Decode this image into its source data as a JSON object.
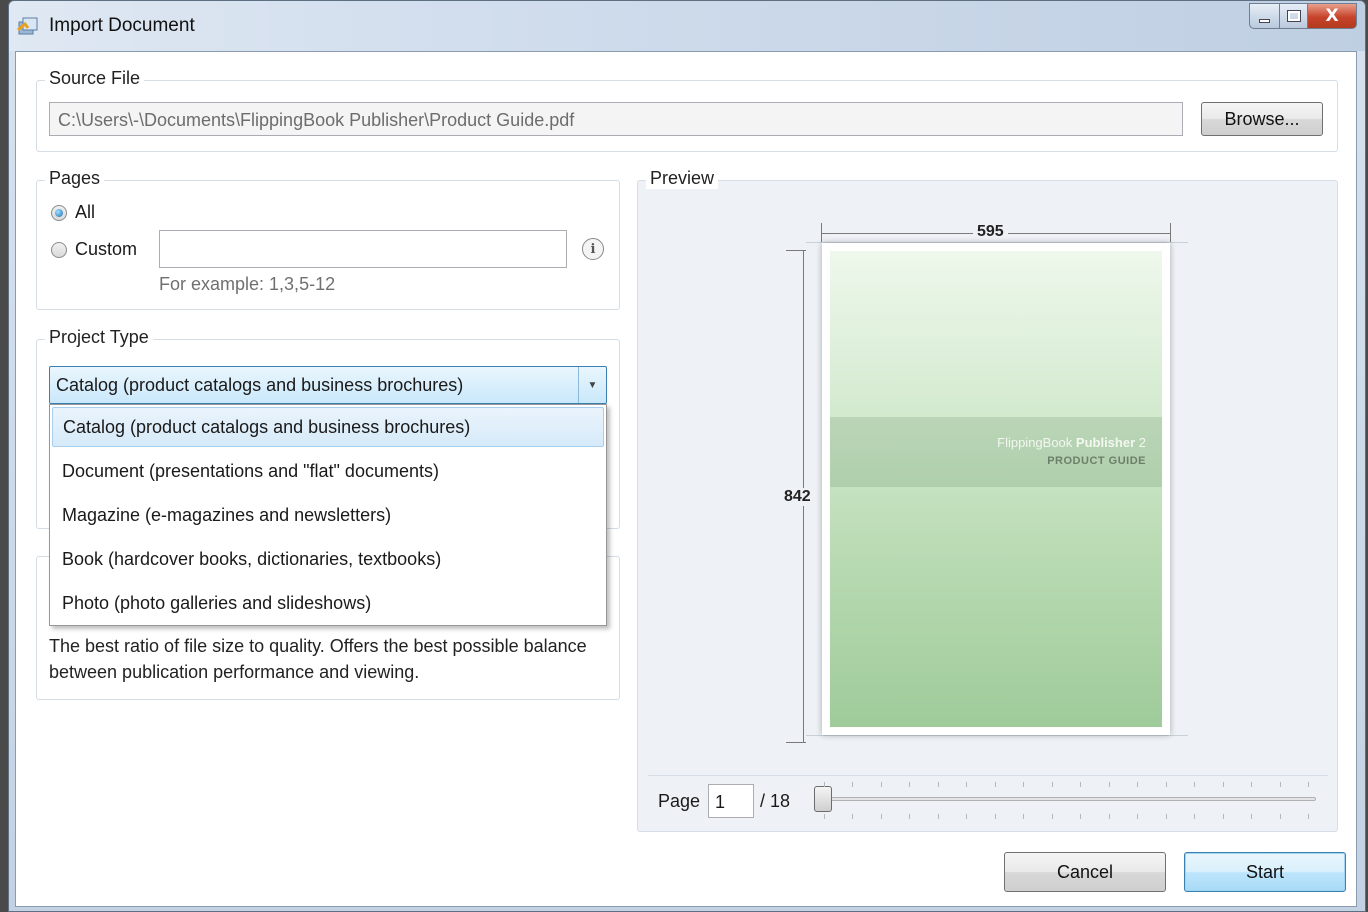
{
  "window": {
    "title": "Import Document",
    "close_glyph": "X"
  },
  "source_file": {
    "legend": "Source File",
    "path": "C:\\Users\\-\\Documents\\FlippingBook Publisher\\Product Guide.pdf",
    "browse_label": "Browse..."
  },
  "pages": {
    "legend": "Pages",
    "all_label": "All",
    "custom_label": "Custom",
    "custom_value": "",
    "hint": "For example: 1,3,5-12",
    "info_glyph": "i",
    "selected": "all"
  },
  "project_type": {
    "legend": "Project Type",
    "selected_value": "Catalog (product catalogs and business brochures)",
    "options": [
      "Catalog (product catalogs and business brochures)",
      "Document (presentations and \"flat\" documents)",
      "Magazine (e-magazines and newsletters)",
      "Book (hardcover books, dictionaries, textbooks)",
      "Photo (photo galleries and slideshows)"
    ],
    "arrow_glyph": "▼"
  },
  "quality": {
    "description": "The best ratio of file size to quality. Offers the best possible balance between publication performance and viewing."
  },
  "preview": {
    "legend": "Preview",
    "width_label": "595",
    "height_label": "842",
    "brand_light": "FlippingBook ",
    "brand_bold": "Publisher",
    "brand_version": " 2",
    "brand_sub": "PRODUCT GUIDE",
    "page_label": "Page",
    "page_value": "1",
    "page_total": "/ 18",
    "slider_position": 0
  },
  "footer": {
    "cancel_label": "Cancel",
    "start_label": "Start"
  },
  "colors": {
    "accent": "#3c7fb1",
    "close_red": "#c7432a"
  }
}
